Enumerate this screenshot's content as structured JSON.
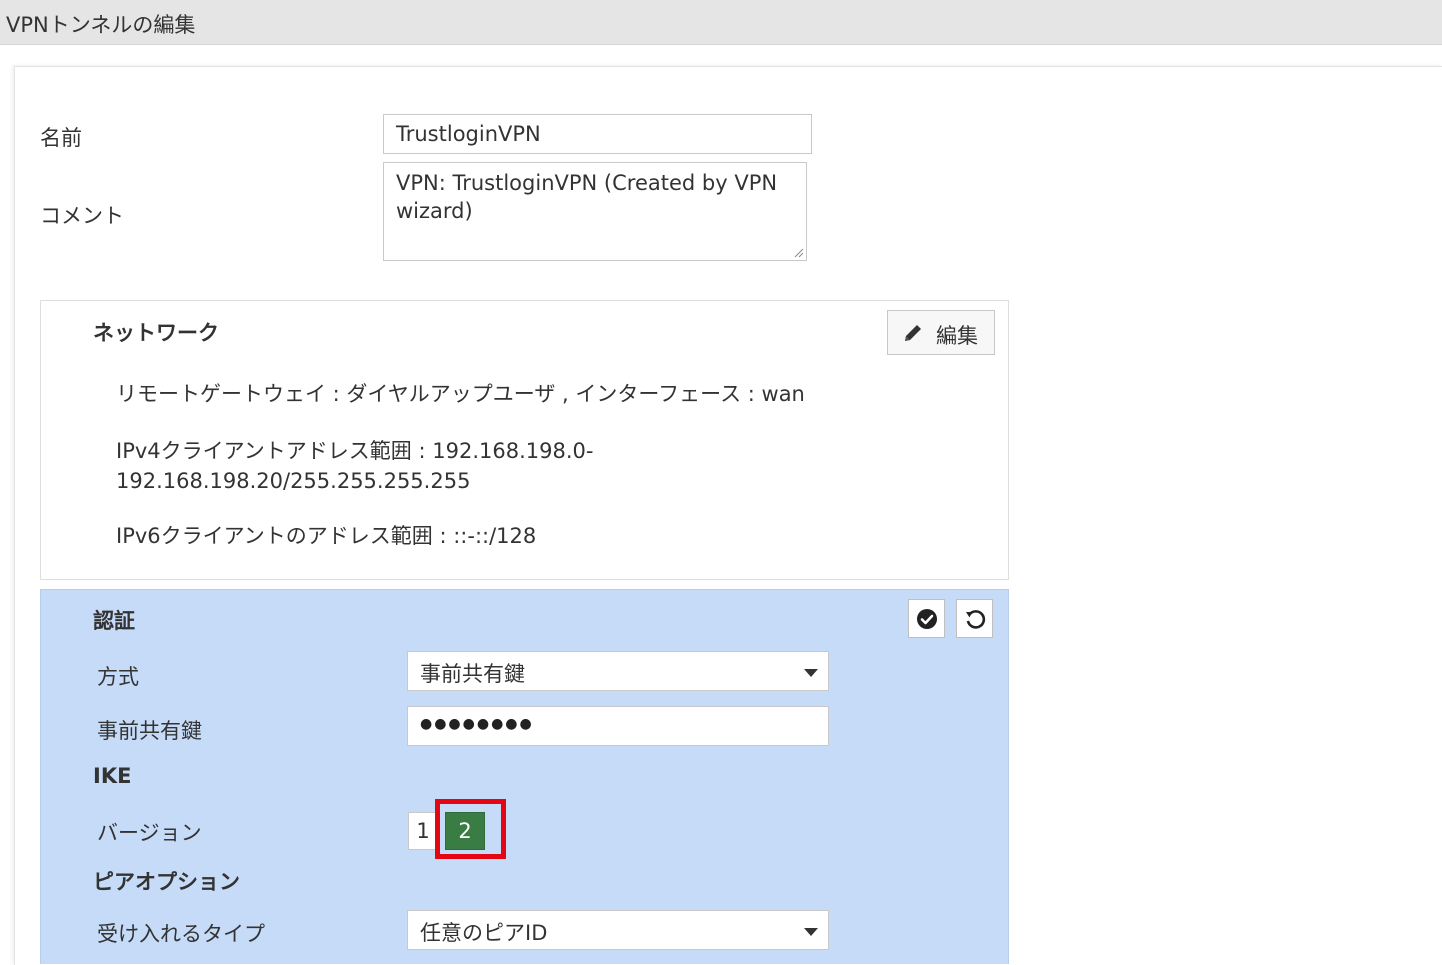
{
  "window": {
    "title": "VPNトンネルの編集"
  },
  "form": {
    "name_label": "名前",
    "name_value": "TrustloginVPN",
    "comment_label": "コメント",
    "comment_value": "VPN: TrustloginVPN (Created by VPN wizard)"
  },
  "network": {
    "heading": "ネットワーク",
    "edit_label": "編集",
    "remote_gateway": "リモートゲートウェイ : ダイヤルアップユーザ , インターフェース : wan",
    "ipv4_range_line1": "IPv4クライアントアドレス範囲 : 192.168.198.0-",
    "ipv4_range_line2": "192.168.198.20/255.255.255.255",
    "ipv6_range": "IPv6クライアントのアドレス範囲 : ::-::/128"
  },
  "auth": {
    "heading": "認証",
    "method_label": "方式",
    "method_value": "事前共有鍵",
    "psk_label": "事前共有鍵",
    "psk_value": "●●●●●●●●",
    "ike_heading": "IKE",
    "version_label": "バージョン",
    "version_options": [
      "1",
      "2"
    ],
    "version_selected": "2",
    "peer_heading": "ピアオプション",
    "accept_type_label": "受け入れるタイプ",
    "accept_type_value": "任意のピアID"
  },
  "colors": {
    "auth_background": "#c6dbf7",
    "selected_version": "#3a7d44",
    "highlight": "#e30613",
    "titlebar": "#e5e5e5"
  },
  "icons": {
    "edit": "pencil-icon",
    "apply": "check-circle-icon",
    "revert": "undo-icon",
    "dropdown": "caret-down-icon"
  }
}
